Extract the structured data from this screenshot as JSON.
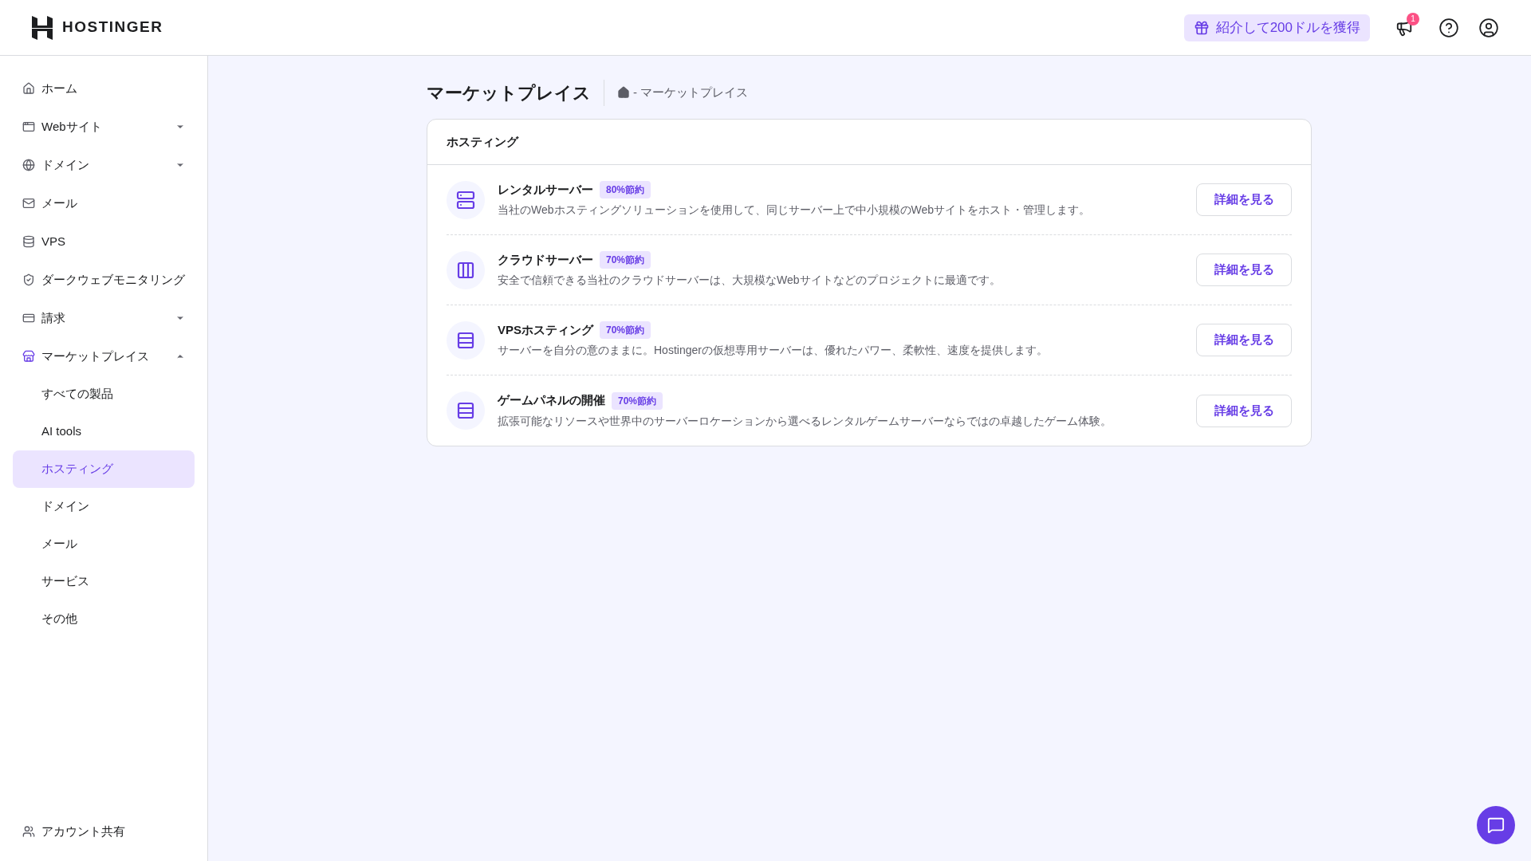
{
  "header": {
    "logo": "HOSTINGER",
    "referral": "紹介して200ドルを獲得",
    "notification_count": "1"
  },
  "sidebar": {
    "items": [
      {
        "label": "ホーム",
        "selected": false
      },
      {
        "label": "Webサイト",
        "expanded": false,
        "selected": false
      },
      {
        "label": "ドメイン",
        "expanded": false,
        "selected": false
      },
      {
        "label": "メール",
        "selected": false
      },
      {
        "label": "VPS",
        "selected": false
      },
      {
        "label": "ダークウェブモニタリング",
        "selected": false
      },
      {
        "label": "請求",
        "expanded": false,
        "selected": false
      },
      {
        "label": "マーケットプレイス",
        "expanded": true,
        "selected": true,
        "children": [
          {
            "label": "すべての製品",
            "selected": false
          },
          {
            "label": "AI tools",
            "selected": false
          },
          {
            "label": "ホスティング",
            "selected": true
          },
          {
            "label": "ドメイン",
            "selected": false
          },
          {
            "label": "メール",
            "selected": false
          },
          {
            "label": "サービス",
            "selected": false
          },
          {
            "label": "その他",
            "selected": false
          }
        ]
      }
    ],
    "footer_item": "アカウント共有"
  },
  "page": {
    "title": "マーケットプレイス",
    "breadcrumb": "- マーケットプレイス"
  },
  "card": {
    "title": "ホスティング",
    "products": [
      {
        "name": "レンタルサーバー",
        "badge": "80%節約",
        "description": "当社のWebホスティングソリューションを使用して、同じサーバー上で中小規模のWebサイトをホスト・管理します。",
        "button": "詳細を見る"
      },
      {
        "name": "クラウドサーバー",
        "badge": "70%節約",
        "description": "安全で信頼できる当社のクラウドサーバーは、大規模なWebサイトなどのプロジェクトに最適です。",
        "button": "詳細を見る"
      },
      {
        "name": "VPSホスティング",
        "badge": "70%節約",
        "description": "サーバーを自分の意のままに。Hostingerの仮想専用サーバーは、優れたパワー、柔軟性、速度を提供します。",
        "button": "詳細を見る"
      },
      {
        "name": "ゲームパネルの開催",
        "badge": "70%節約",
        "description": "拡張可能なリソースや世界中のサーバーロケーションから選べるレンタルゲームサーバーならではの卓越したゲーム体験。",
        "button": "詳細を見る"
      }
    ]
  }
}
